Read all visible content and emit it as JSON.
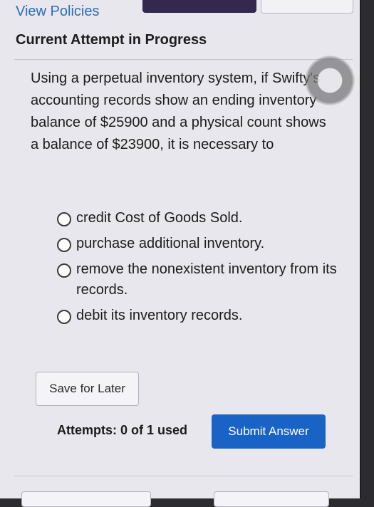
{
  "header": {
    "view_policies_link": "View Policies",
    "attempt_status": "Current Attempt in Progress"
  },
  "question": {
    "text": "Using a perpetual inventory system, if Swifty's accounting records show an ending inventory balance of $25900 and a physical count shows a balance of $23900, it is necessary to"
  },
  "options": [
    {
      "label": "credit Cost of Goods Sold.",
      "selected": false
    },
    {
      "label": "purchase additional inventory.",
      "selected": false
    },
    {
      "label": "remove the nonexistent inventory from its records.",
      "selected": false
    },
    {
      "label": "debit its inventory records.",
      "selected": false
    }
  ],
  "actions": {
    "save_label": "Save for Later",
    "submit_label": "Submit Answer"
  },
  "attempts": {
    "text": "Attempts: 0 of 1 used"
  },
  "colors": {
    "link": "#2d6db3",
    "submit_button": "#1a63c6",
    "background": "#e9e7ee"
  }
}
